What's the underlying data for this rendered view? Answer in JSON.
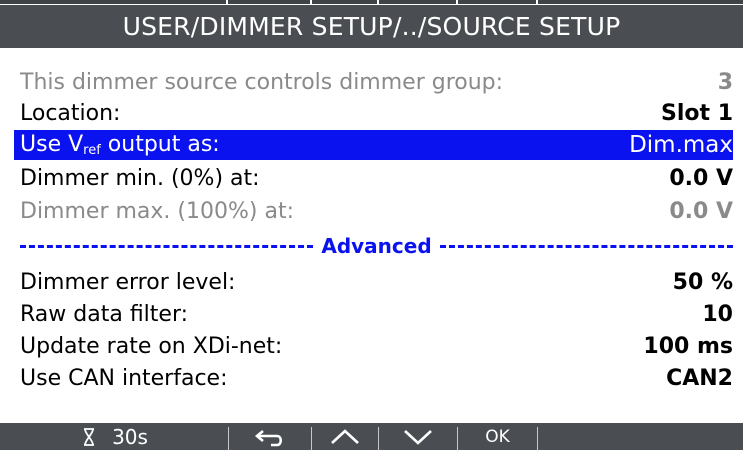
{
  "header": {
    "title": "USER/DIMMER SETUP/../SOURCE SETUP"
  },
  "rows": [
    {
      "label": "This dimmer source controls dimmer group:",
      "value": "3"
    },
    {
      "label": "Location:",
      "value": "Slot 1"
    },
    {
      "label_pre": "Use V",
      "label_sub": "ref",
      "label_post": " output as:",
      "value": "Dim.max"
    },
    {
      "label": "Dimmer min. (0%) at:",
      "value": "0.0 V"
    },
    {
      "label": "Dimmer max. (100%) at:",
      "value": "0.0 V"
    }
  ],
  "separator": {
    "label": "Advanced"
  },
  "advanced_rows": [
    {
      "label": "Dimmer error level:",
      "value": "50 %"
    },
    {
      "label": "Raw data filter:",
      "value": "10"
    },
    {
      "label": "Update rate on XDi-net:",
      "value": "100 ms"
    },
    {
      "label": "Use CAN interface:",
      "value": "CAN2"
    }
  ],
  "footer": {
    "timer_icon": "hourglass-icon",
    "timer_label": "30s",
    "back_icon": "return-arrow-icon",
    "up_icon": "chevron-up-icon",
    "down_icon": "chevron-down-icon",
    "ok_label": "OK"
  },
  "colors": {
    "header_bg": "#4a4e52",
    "selection": "#0a12ef",
    "dim_text": "#8a8a8a"
  }
}
